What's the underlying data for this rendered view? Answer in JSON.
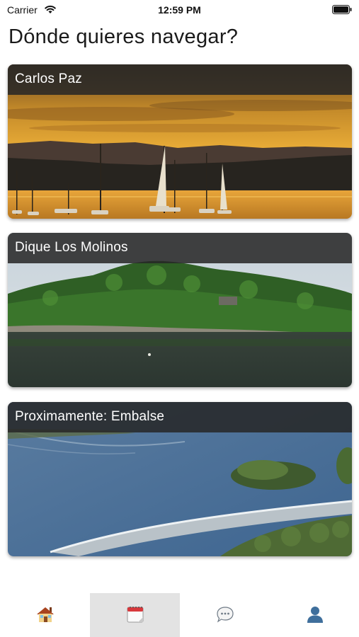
{
  "status_bar": {
    "carrier": "Carrier",
    "time": "12:59 PM",
    "wifi_icon": "wifi-icon",
    "battery_icon": "battery-icon"
  },
  "header": {
    "title": "Dónde quieres navegar?"
  },
  "destinations": [
    {
      "title": "Carlos Paz",
      "image": "sunset-lake-with-sailboats"
    },
    {
      "title": "Dique Los Molinos",
      "image": "green-hills-reservoir"
    },
    {
      "title": "Proximamente: Embalse",
      "image": "reservoir-dam-aerial"
    }
  ],
  "tab_bar": {
    "tabs": [
      {
        "icon": "house-icon",
        "active": false
      },
      {
        "icon": "calendar-icon",
        "active": true
      },
      {
        "icon": "chat-bubble-icon",
        "active": false
      },
      {
        "icon": "user-icon",
        "active": false
      }
    ],
    "active_color": "#e3e3e3"
  }
}
